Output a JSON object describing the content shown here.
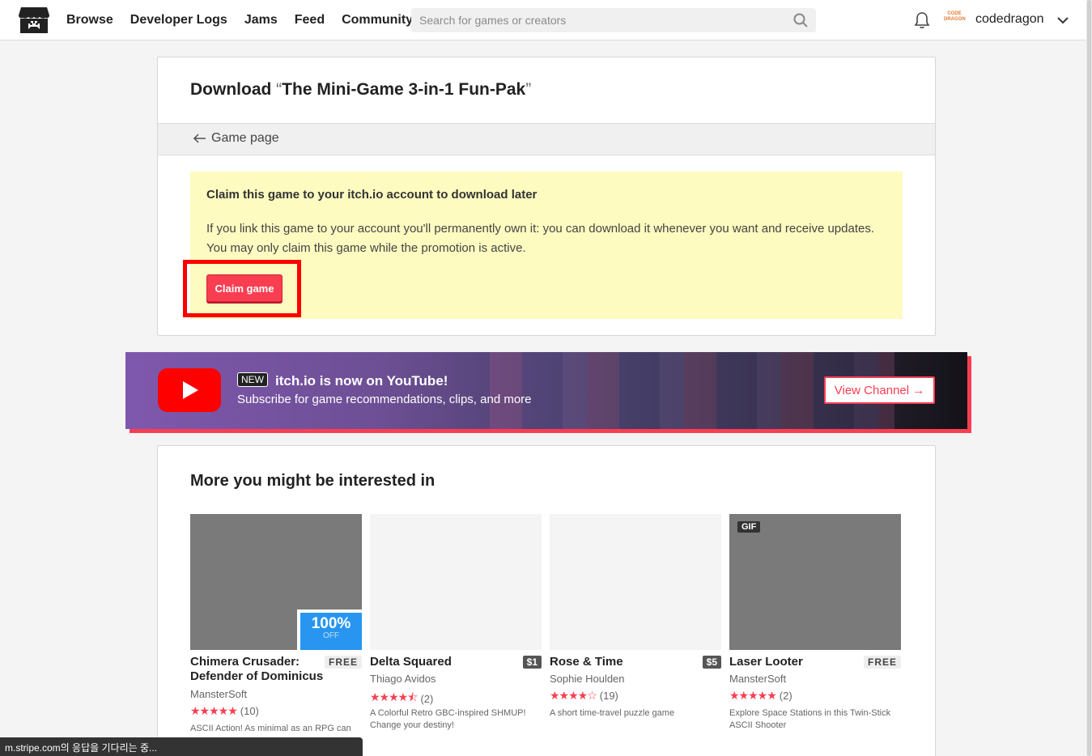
{
  "header": {
    "nav": [
      "Browse",
      "Developer Logs",
      "Jams",
      "Feed",
      "Community"
    ],
    "search_placeholder": "Search for games or creators",
    "avatar_text": "CODE DRAGON",
    "username": "codedragon"
  },
  "panel": {
    "title_prefix": "Download ",
    "open_quote": "“",
    "game_name": "The Mini-Game 3-in-1 Fun-Pak",
    "close_quote": "”",
    "back_link": "Game page",
    "claim_title": "Claim this game to your itch.io account to download later",
    "claim_text": "If you link this game to your account you'll permanently own it: you can download it whenever you want and receive updates. You may only claim this game while the promotion is active.",
    "claim_button": "Claim game"
  },
  "youtube": {
    "badge": "NEW",
    "headline": "itch.io is now on YouTube!",
    "sub": "Subscribe for game recommendations, clips, and more",
    "button": "View Channel →"
  },
  "recs": {
    "title": "More you might be interested in",
    "cards": [
      {
        "title": "Chimera Crusader: Defender of Dominicus",
        "price": "FREE",
        "author": "MansterSoft",
        "stars": "★★★★★",
        "count": "(10)",
        "desc": "ASCII Action! As minimal as an RPG can",
        "sale_pct": "100%",
        "sale_off": "OFF"
      },
      {
        "title": "Delta Squared",
        "price": "$1",
        "author": "Thiago Avidos",
        "stars": "★★★★⯪",
        "count": "(2)",
        "desc": "A Colorful Retro GBC-inspired SHMUP! Change your destiny!"
      },
      {
        "title": "Rose & Time",
        "price": "$5",
        "author": "Sophie Houlden",
        "stars": "★★★★☆",
        "count": "(19)",
        "desc": "A short time-travel puzzle game"
      },
      {
        "title": "Laser Looter",
        "price": "FREE",
        "author": "MansterSoft",
        "stars": "★★★★★",
        "count": "(2)",
        "desc": "Explore Space Stations in this Twin-Stick ASCII Shooter",
        "gif": "GIF"
      }
    ]
  },
  "statusbar": "m.stripe.com의 응답을 기다리는 중..."
}
